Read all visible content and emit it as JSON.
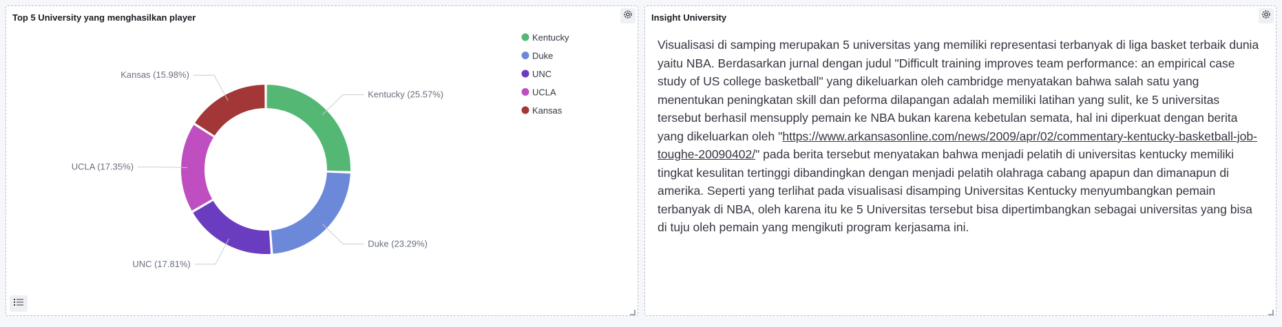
{
  "left_panel": {
    "title": "Top 5 University yang menghasilkan player",
    "icons": [
      "gear-icon",
      "legend-list-icon",
      "resize-handle-icon"
    ]
  },
  "right_panel": {
    "title": "Insight University",
    "text_before_link": "Visualisasi di samping merupakan 5 universitas yang memiliki representasi terbanyak di liga basket terbaik dunia yaitu NBA. Berdasarkan jurnal dengan judul \"Difficult training improves team performance: an empirical case study of US college basketball\" yang dikeluarkan oleh cambridge menyatakan bahwa salah satu yang menentukan peningkatan skill dan peforma dilapangan adalah memiliki latihan yang sulit, ke 5 universitas tersebut berhasil mensupply pemain ke NBA bukan karena kebetulan semata, hal ini diperkuat dengan berita yang dikeluarkan oleh \"",
    "link_text": "https://www.arkansasonline.com/news/2009/apr/02/commentary-kentucky-basketball-job-toughe-20090402/",
    "text_after_link": "\" pada berita tersebut menyatakan bahwa menjadi pelatih di universitas kentucky memiliki tingkat kesulitan tertinggi dibandingkan dengan menjadi pelatih olahraga cabang apapun dan dimanapun di amerika. Seperti yang terlihat pada visualisasi disamping Universitas Kentucky menyumbangkan pemain terbanyak di NBA, oleh karena itu ke 5 Universitas tersebut bisa dipertimbangkan sebagai universitas yang bisa di tuju oleh pemain yang mengikuti program kerjasama ini."
  },
  "chart_data": {
    "type": "pie",
    "donut": true,
    "title": "Top 5 University yang menghasilkan player",
    "legend_position": "top-right",
    "slices": [
      {
        "label": "Kentucky",
        "value": 25.57,
        "display": "Kentucky (25.57%)",
        "color": "#54b773"
      },
      {
        "label": "Duke",
        "value": 23.29,
        "display": "Duke (23.29%)",
        "color": "#6c88d9"
      },
      {
        "label": "UNC",
        "value": 17.81,
        "display": "UNC (17.81%)",
        "color": "#6a3cbf"
      },
      {
        "label": "UCLA",
        "value": 17.35,
        "display": "UCLA (17.35%)",
        "color": "#bf4fc0"
      },
      {
        "label": "Kansas",
        "value": 15.98,
        "display": "Kansas (15.98%)",
        "color": "#a33636"
      }
    ]
  }
}
